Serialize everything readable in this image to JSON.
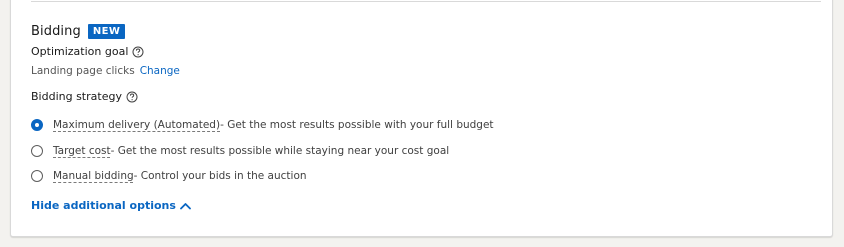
{
  "bidding": {
    "title": "Bidding",
    "badge": "NEW",
    "optimization_goal_label": "Optimization goal",
    "optimization_goal_value": "Landing page clicks",
    "change_link": "Change",
    "bidding_strategy_label": "Bidding strategy",
    "options": [
      {
        "name": "Maximum delivery (Automated)",
        "description": " - Get the most results possible with your full budget",
        "selected": true
      },
      {
        "name": "Target cost",
        "description": " - Get the most results possible while staying near your cost goal",
        "selected": false
      },
      {
        "name": "Manual bidding",
        "description": " - Control your bids in the auction",
        "selected": false
      }
    ],
    "hide_options_link": "Hide additional options"
  },
  "colors": {
    "accent": "#0a66c2",
    "page_background": "#f3f2ef",
    "card_background": "#ffffff"
  },
  "icons": {
    "help": "question-circle-icon",
    "collapse": "chevron-up-icon"
  }
}
